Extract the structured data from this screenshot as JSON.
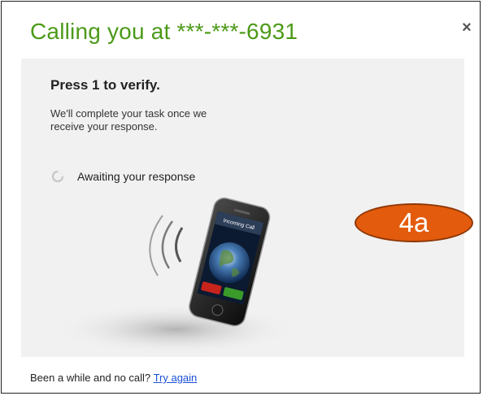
{
  "dialog": {
    "title": "Calling you at ***-***-6931",
    "close_glyph": "×"
  },
  "main": {
    "instruction": "Press 1 to verify.",
    "description": "We'll complete your task once we receive your response.",
    "status_text": "Awaiting your response",
    "status_icon": "spinner-icon",
    "illustration": "ringing-phone-icon",
    "phone_screen_caller": "Incoming Call"
  },
  "annotation": {
    "label": "4a",
    "color": "#e35b0d"
  },
  "footer": {
    "text": "Been a while and no call?",
    "link": "Try again"
  },
  "colors": {
    "title": "#4c9a18",
    "panel": "#f1f1f1",
    "link": "#1a4fd6"
  }
}
